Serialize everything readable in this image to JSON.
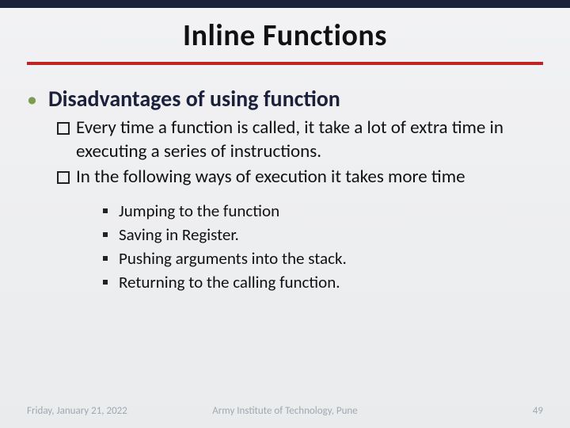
{
  "title": "Inline Functions",
  "heading": "Disadvantages of using function",
  "points": [
    "Every time a function is called, it take a lot of extra time in executing a series of instructions.",
    "In the following ways of execution it takes more time"
  ],
  "subpoints": [
    "Jumping to the function",
    "Saving in Register.",
    "Pushing arguments into the stack.",
    "Returning to the calling function."
  ],
  "footer": {
    "date": "Friday, January 21, 2022",
    "org": "Army Institute of Technology, Pune",
    "page": "49"
  }
}
